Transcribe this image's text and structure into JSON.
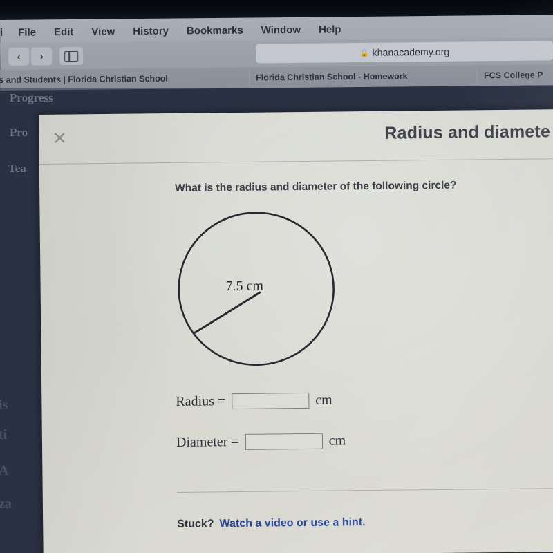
{
  "browser": {
    "app_name": "Safari",
    "menus": [
      "ri",
      "File",
      "Edit",
      "View",
      "History",
      "Bookmarks",
      "Window",
      "Help"
    ],
    "toolbar": {
      "back_icon": "chevron-left-icon",
      "forward_icon": "chevron-right-icon",
      "sidebar_icon": "sidebar-toggle-icon",
      "lock_icon": "lock-icon",
      "url": "khanacademy.org"
    },
    "tabs": [
      "ts and Students | Florida Christian School",
      "Florida Christian School - Homework",
      "FCS College P"
    ]
  },
  "page_background": {
    "items": [
      "Progress",
      "Pro",
      "Tea"
    ],
    "left_fragments": [
      "is",
      "ti",
      "A",
      "za"
    ]
  },
  "modal": {
    "close_icon": "close-icon",
    "title": "Radius and diamete",
    "question": "What is the radius and diameter of the following circle?",
    "figure": {
      "shape": "circle",
      "radius_label": "7.5 cm",
      "radius_value": 7.5,
      "units": "cm"
    },
    "answers": [
      {
        "label": "Radius =",
        "value": "",
        "unit": "cm"
      },
      {
        "label": "Diameter =",
        "value": "",
        "unit": "cm"
      }
    ],
    "footer": {
      "stuck_label": "Stuck?",
      "hint_link": "Watch a video or use a hint."
    }
  },
  "colors": {
    "modal_bg": "#d8d9d3",
    "link_blue": "#28489b",
    "text_dark": "#33373e",
    "page_nav_bg": "#293041",
    "stroke": "#262a30"
  }
}
